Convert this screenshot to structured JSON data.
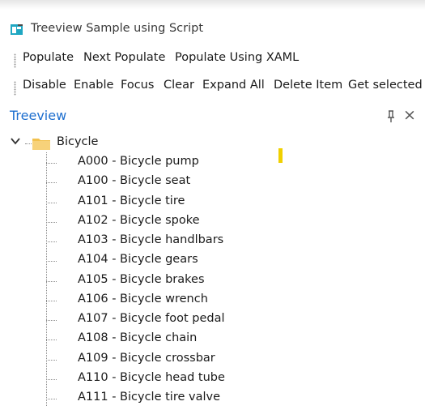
{
  "window": {
    "title": "Treeview Sample using Script",
    "icon": "app-window-icon"
  },
  "toolbar1": {
    "populate": "Populate",
    "next_populate": "Next Populate",
    "populate_xaml": "Populate Using XAML"
  },
  "toolbar2": {
    "disable": "Disable",
    "enable": "Enable",
    "focus": "Focus",
    "clear": "Clear",
    "expand_all": "Expand All",
    "delete_item": "Delete Item",
    "get_selected": "Get selected"
  },
  "panel": {
    "title": "Treeview",
    "pin_icon": "pin-icon",
    "close_icon": "close-icon"
  },
  "tree": {
    "root": {
      "label": "Bicycle",
      "expanded": true,
      "icon": "folder-icon"
    },
    "children": [
      "A000 - Bicycle pump",
      "A100 - Bicycle seat",
      "A101 - Bicycle tire",
      "A102 - Bicycle spoke",
      "A103 - Bicycle handlbars",
      "A104 - Bicycle gears",
      "A105 - Bicycle brakes",
      "A106 - Bicycle wrench",
      "A107 - Bicycle foot pedal",
      "A108 - Bicycle chain",
      "A109 - Bicycle crossbar",
      "A110 - Bicycle head tube",
      "A111 - Bicycle tire valve"
    ]
  },
  "colors": {
    "panel_title": "#1e6fcf",
    "folder": "#f2c14e",
    "caret": "#f0d000",
    "app_icon": "#1fa7c2"
  }
}
